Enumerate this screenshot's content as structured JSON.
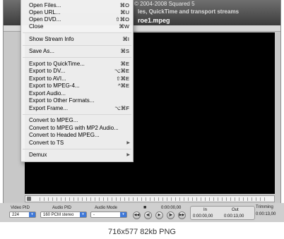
{
  "window": {
    "copyright": "© 2004-2008 Squared 5",
    "subtitle": "les, QuickTime and transport streams",
    "filename": "roe1.mpeg"
  },
  "menu": {
    "items": [
      {
        "label": "Open Files...",
        "shortcut": "⌘O"
      },
      {
        "label": "Open URL...",
        "shortcut": "⌘U"
      },
      {
        "label": "Open DVD...",
        "shortcut": "⇧⌘O"
      },
      {
        "label": "Close",
        "shortcut": "⌘W"
      },
      {
        "label": "Show Stream Info",
        "shortcut": "⌘I"
      },
      {
        "label": "Save As...",
        "shortcut": "⌘S"
      },
      {
        "label": "Export to QuickTime...",
        "shortcut": "⌘E"
      },
      {
        "label": "Export to DV...",
        "shortcut": "⌥⌘E"
      },
      {
        "label": "Export to AVI...",
        "shortcut": "⇧⌘E"
      },
      {
        "label": "Export to MPEG-4...",
        "shortcut": "^⌘E"
      },
      {
        "label": "Export Audio...",
        "shortcut": ""
      },
      {
        "label": "Export to Other Formats...",
        "shortcut": ""
      },
      {
        "label": "Export Frame...",
        "shortcut": "⌥⌘F"
      },
      {
        "label": "Convert to MPEG...",
        "shortcut": ""
      },
      {
        "label": "Convert to MPEG with MP2 Audio...",
        "shortcut": ""
      },
      {
        "label": "Convert to Headed MPEG...",
        "shortcut": ""
      },
      {
        "label": "Convert to TS",
        "shortcut": ""
      },
      {
        "label": "Demux",
        "shortcut": ""
      }
    ]
  },
  "controls": {
    "video_pid_label": "Video PID",
    "video_pid_value": "224",
    "audio_pid_label": "Audio PID",
    "audio_pid_value": "160 PCM stereo",
    "audio_mode_label": "Audio Mode",
    "audio_mode_value": "-",
    "time_current": "0:00:00,00",
    "in_label": "In",
    "out_label": "Out",
    "in_time": "0:00:00,00",
    "out_time": "0:00:13,00",
    "trimming_label": "Trimming",
    "trimming_time": "0:00:13,00"
  },
  "status_bar": "716x577 82kb PNG"
}
